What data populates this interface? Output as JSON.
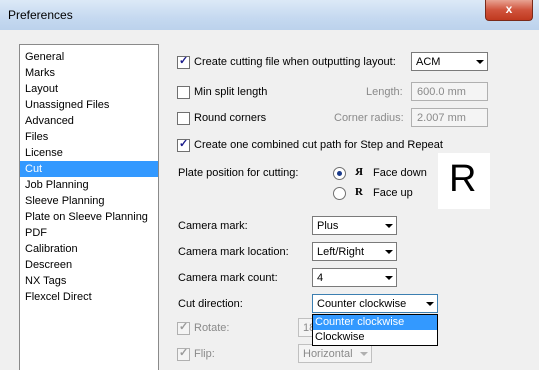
{
  "window": {
    "title": "Preferences",
    "close_glyph": "x"
  },
  "nav": {
    "items": [
      "General",
      "Marks",
      "Layout",
      "Unassigned Files",
      "Advanced",
      "Files",
      "License",
      "Cut",
      "Job Planning",
      "Sleeve Planning",
      "Plate on Sleeve Planning",
      "PDF",
      "Calibration",
      "Descreen",
      "NX Tags",
      "Flexcel Direct"
    ],
    "selected": "Cut"
  },
  "cut": {
    "create_cutting_file": {
      "label": "Create cutting file when outputting layout:",
      "checked": true,
      "format": "ACM"
    },
    "min_split": {
      "label": "Min split length",
      "checked": false,
      "length_label": "Length:",
      "length_value": "600.0 mm"
    },
    "round_corners": {
      "label": "Round corners",
      "checked": false,
      "radius_label": "Corner radius:",
      "radius_value": "2.007 mm"
    },
    "combined_path": {
      "label": "Create one combined cut path for Step and Repeat",
      "checked": true
    },
    "plate_position": {
      "label": "Plate position for cutting:",
      "face_down": "Face down",
      "face_up": "Face up",
      "face_down_icon": "R-mirrored",
      "face_up_icon": "R",
      "selected": "Face down",
      "preview_glyph": "R"
    },
    "camera_mark": {
      "label": "Camera mark:",
      "value": "Plus"
    },
    "camera_mark_location": {
      "label": "Camera mark location:",
      "value": "Left/Right"
    },
    "camera_mark_count": {
      "label": "Camera mark count:",
      "value": "4"
    },
    "cut_direction": {
      "label": "Cut direction:",
      "value": "Counter clockwise",
      "options": [
        "Counter clockwise",
        "Clockwise"
      ],
      "highlighted": "Counter clockwise"
    },
    "rotate": {
      "label": "Rotate:",
      "checked": true,
      "disabled": true,
      "value": "18"
    },
    "flip": {
      "label": "Flip:",
      "checked": true,
      "disabled": true,
      "value": "Horizontal"
    }
  }
}
